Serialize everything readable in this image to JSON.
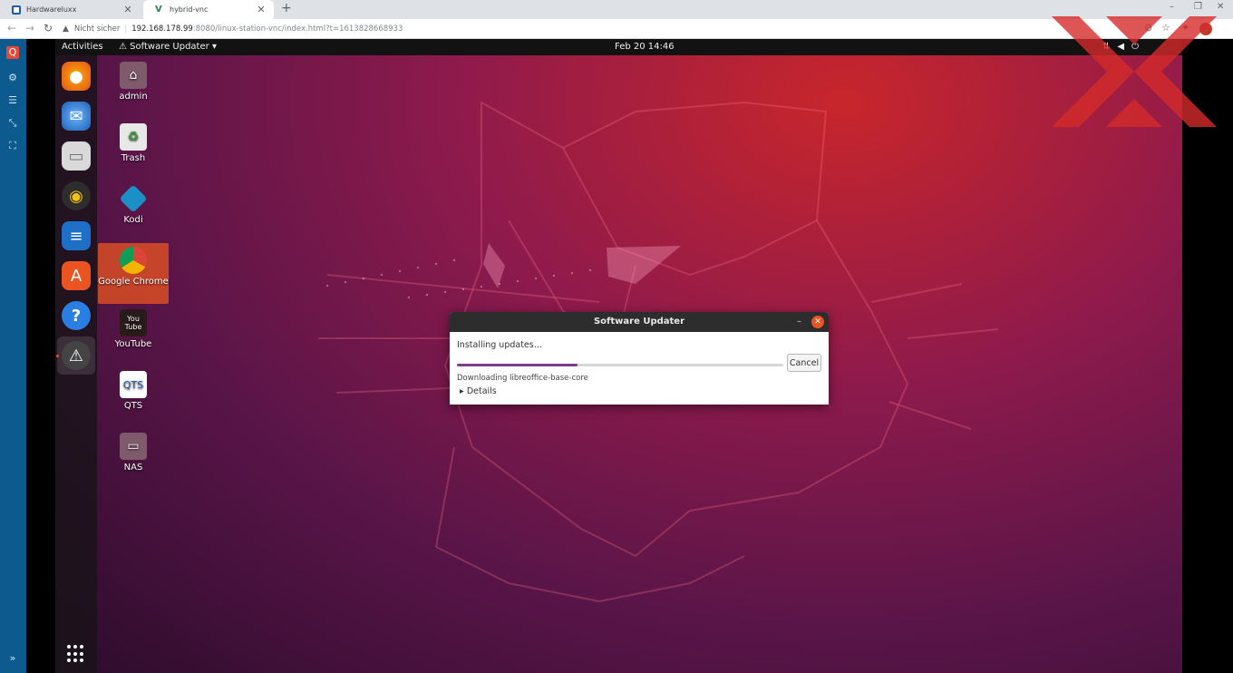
{
  "browser": {
    "tabs": [
      {
        "label": "Hardwareluxx"
      },
      {
        "label": "hybrid-vnc"
      }
    ],
    "new_tab": "+",
    "window_controls": {
      "minimize": "–",
      "maximize": "❐",
      "close": "✕"
    },
    "address": {
      "security": "Nicht sicher",
      "host": "192.168.178.99",
      "path": ":8080/linux-station-vnc/index.html?t=1613828668933"
    }
  },
  "topbar": {
    "activities": "Activities",
    "app_name": "Software Updater",
    "clock": "Feb 20  14:46"
  },
  "desktop_icons": [
    {
      "label": "admin"
    },
    {
      "label": "Trash"
    },
    {
      "label": "Kodi"
    },
    {
      "label": "Google Chrome"
    },
    {
      "label": "YouTube"
    },
    {
      "label": "QTS"
    },
    {
      "label": "NAS"
    }
  ],
  "dialog": {
    "title": "Software Updater",
    "status": "Installing updates…",
    "progress": 0.37,
    "cancel_label": "Cancel",
    "sub_status": "Downloading libreoffice-base-core",
    "details_label": "Details"
  },
  "colors": {
    "accent": "#e95420",
    "progress": "#7b3f8a",
    "watermark": "#d42a2a"
  }
}
